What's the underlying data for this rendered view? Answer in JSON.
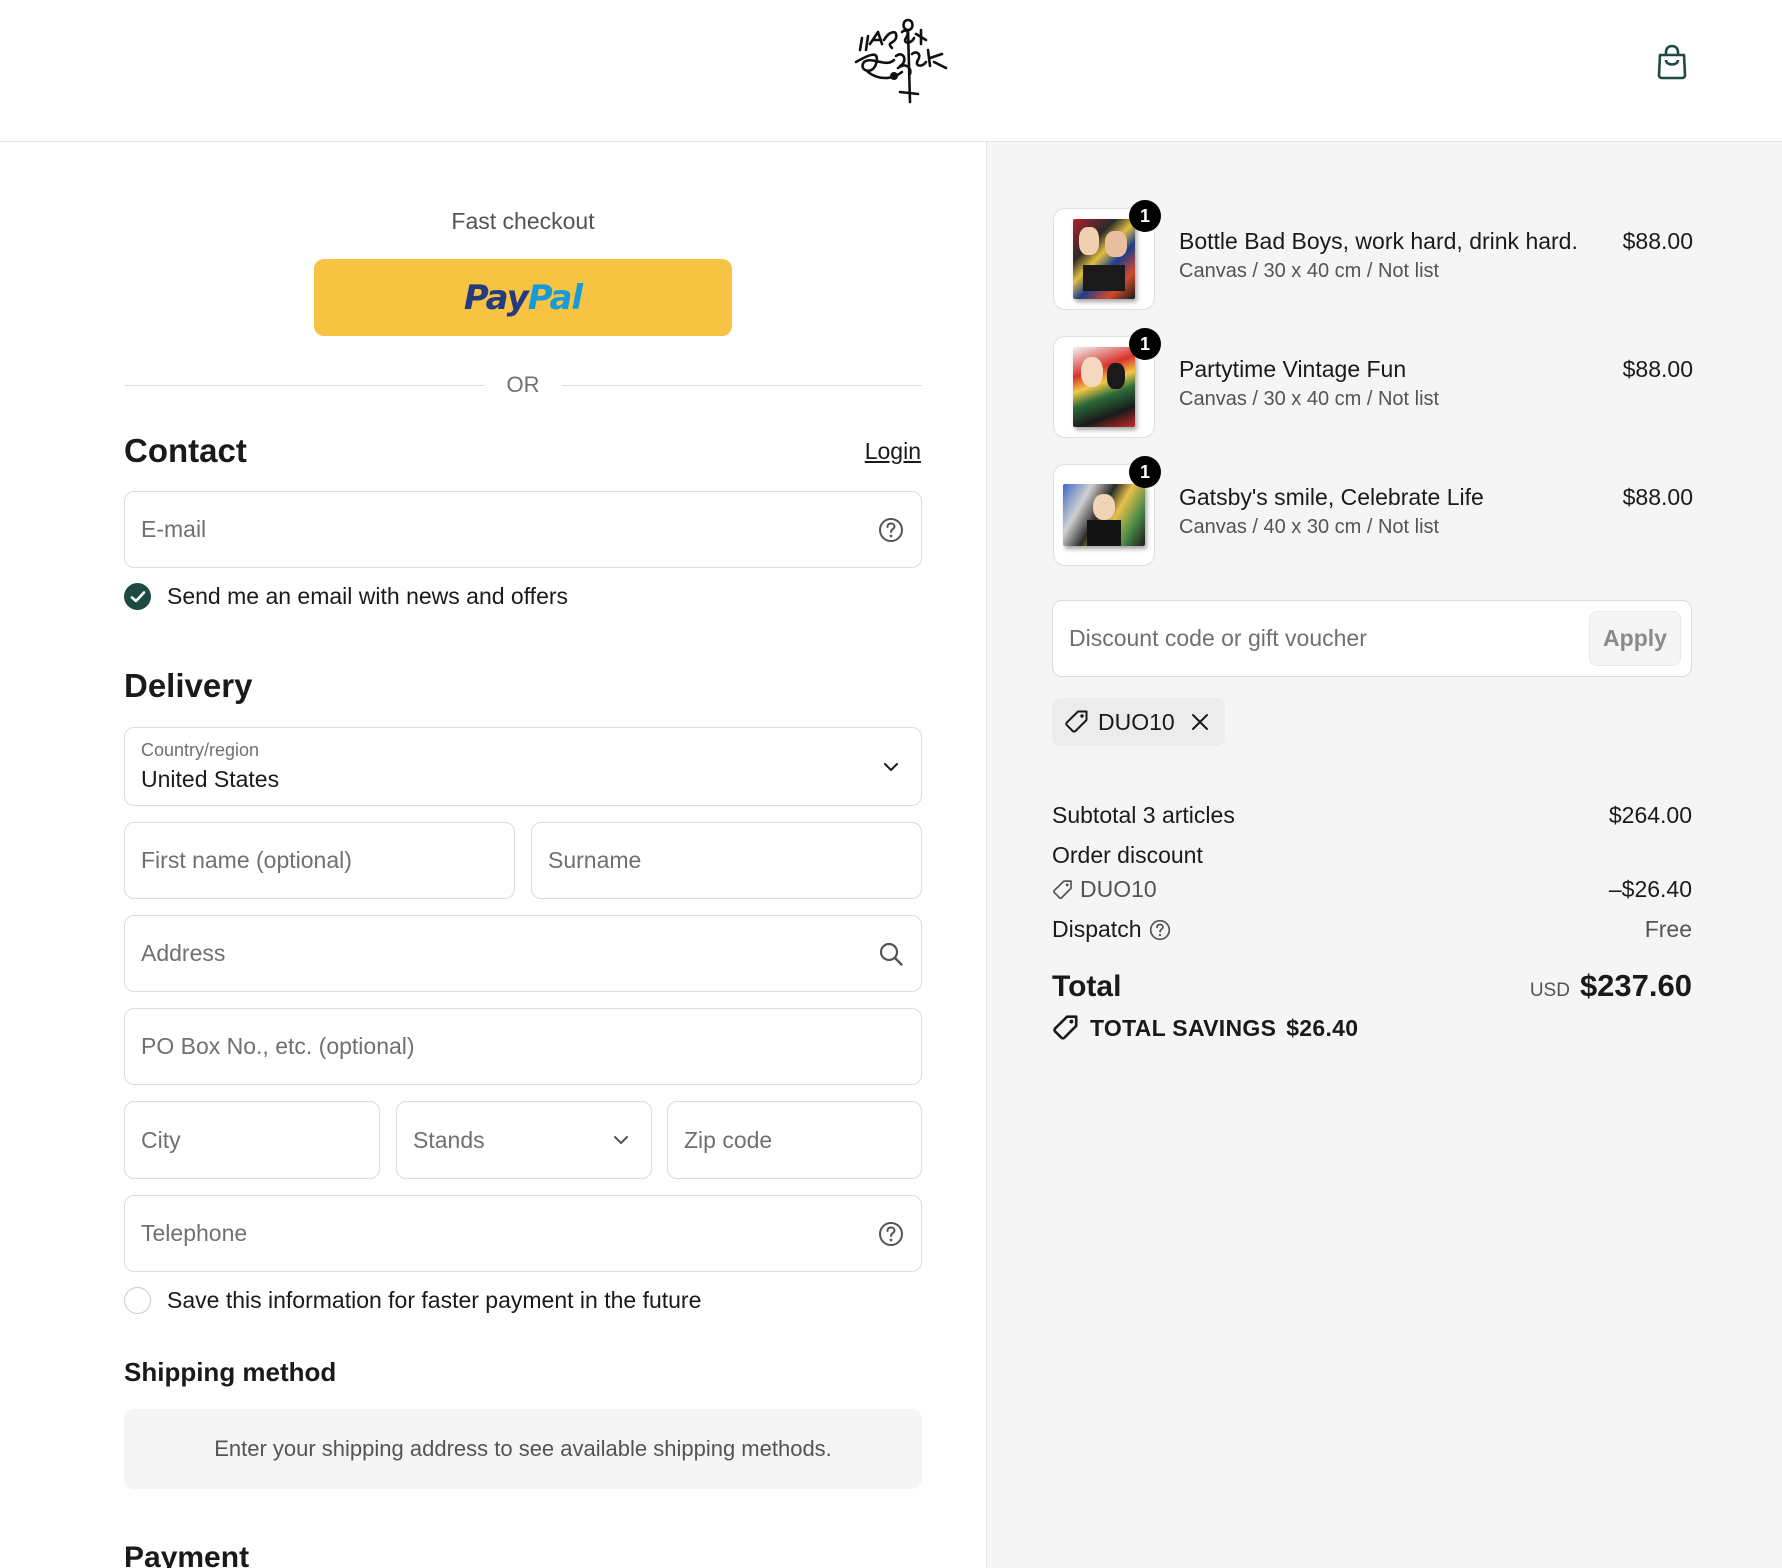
{
  "header": {
    "logo_icon": "hans-breuer-signature-logo",
    "cart_icon": "shopping-bag-icon"
  },
  "fast_checkout": {
    "title": "Fast checkout",
    "paypal_part1": "Pay",
    "paypal_part2": "Pal",
    "or": "OR"
  },
  "contact": {
    "title": "Contact",
    "login": "Login",
    "email_placeholder": "E-mail",
    "newsletter_label": "Send me an email with news and offers",
    "newsletter_checked": true
  },
  "delivery": {
    "title": "Delivery",
    "country_label": "Country/region",
    "country_value": "United States",
    "first_name_placeholder": "First name (optional)",
    "surname_placeholder": "Surname",
    "address_placeholder": "Address",
    "po_box_placeholder": "PO Box No., etc. (optional)",
    "city_placeholder": "City",
    "state_placeholder": "Stands",
    "zip_placeholder": "Zip code",
    "telephone_placeholder": "Telephone",
    "save_info_label": "Save this information for faster payment in the future",
    "save_info_checked": false
  },
  "shipping": {
    "title": "Shipping method",
    "notice": "Enter your shipping address to see available shipping methods."
  },
  "payment": {
    "title": "Payment"
  },
  "order": {
    "items": [
      {
        "name": "Bottle Bad Boys, work hard, drink hard.",
        "meta": "Canvas / 30 x 40 cm / Not list",
        "price": "$88.00",
        "qty": "1"
      },
      {
        "name": "Partytime Vintage Fun",
        "meta": "Canvas / 30 x 40 cm / Not list",
        "price": "$88.00",
        "qty": "1"
      },
      {
        "name": "Gatsby's smile, Celebrate Life",
        "meta": "Canvas / 40 x 30 cm / Not list",
        "price": "$88.00",
        "qty": "1"
      }
    ],
    "discount_placeholder": "Discount code or gift voucher",
    "apply": "Apply",
    "applied_code": "DUO10",
    "subtotal_label": "Subtotal 3 articles",
    "subtotal_value": "$264.00",
    "order_discount_label": "Order discount",
    "order_discount_code": "DUO10",
    "order_discount_value": "–$26.40",
    "dispatch_label": "Dispatch",
    "dispatch_value": "Free",
    "total_label": "Total",
    "total_currency": "USD",
    "total_value": "$237.60",
    "total_savings_label": "TOTAL SAVINGS",
    "total_savings_value": "$26.40"
  },
  "colors": {
    "paypal_yellow": "#f6c343",
    "paypal_navy": "#253b80",
    "paypal_blue": "#179bd7",
    "checkbox_green": "#1f4a42",
    "summary_bg": "#f5f5f5"
  }
}
